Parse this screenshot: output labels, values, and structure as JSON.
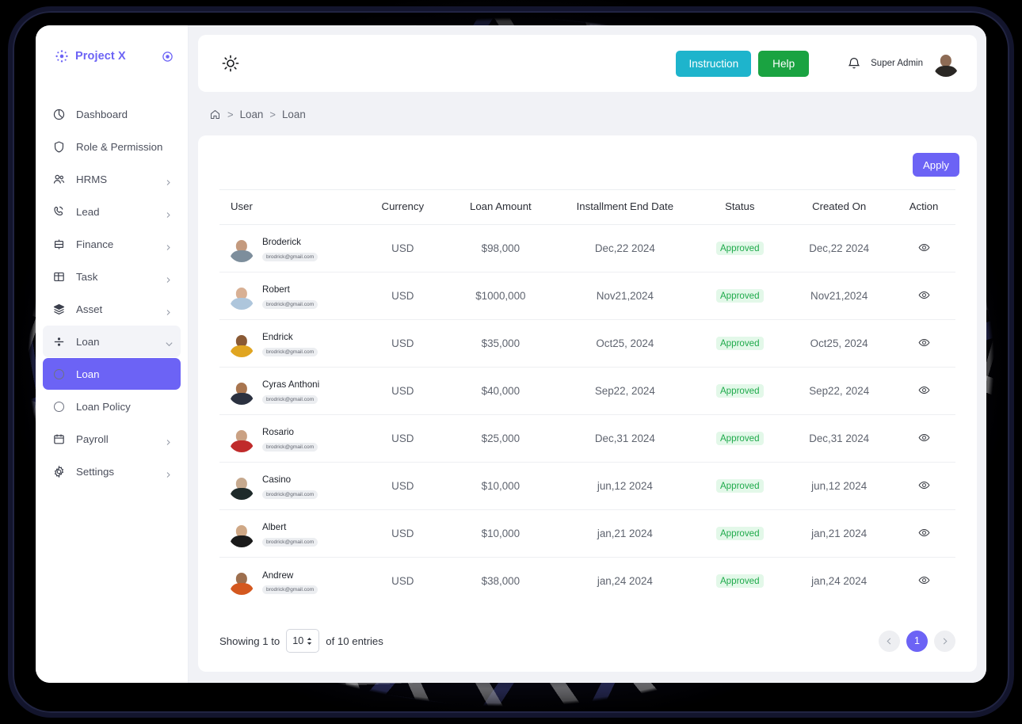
{
  "brand": {
    "name": "Project X",
    "logo_icon": "sparkle-icon",
    "collapse_icon": "circle-target-icon"
  },
  "sidebar": {
    "items": [
      {
        "label": "Dashboard",
        "icon": "pie-chart-icon",
        "expandable": false,
        "state": "normal"
      },
      {
        "label": "Role & Permission",
        "icon": "shield-icon",
        "expandable": false,
        "state": "normal"
      },
      {
        "label": "HRMS",
        "icon": "users-icon",
        "expandable": true,
        "state": "normal"
      },
      {
        "label": "Lead",
        "icon": "phone-icon",
        "expandable": true,
        "state": "normal"
      },
      {
        "label": "Finance",
        "icon": "bank-icon",
        "expandable": true,
        "state": "normal"
      },
      {
        "label": "Task",
        "icon": "grid-icon",
        "expandable": true,
        "state": "normal"
      },
      {
        "label": "Asset",
        "icon": "layers-icon",
        "expandable": true,
        "state": "normal"
      },
      {
        "label": "Loan",
        "icon": "divide-icon",
        "expandable": true,
        "state": "open"
      },
      {
        "label": "Loan",
        "icon": "circle-icon",
        "expandable": false,
        "state": "active",
        "sub": true
      },
      {
        "label": "Loan Policy",
        "icon": "circle-icon",
        "expandable": false,
        "state": "normal",
        "sub": true
      },
      {
        "label": "Payroll",
        "icon": "calendar-icon",
        "expandable": true,
        "state": "normal"
      },
      {
        "label": "Settings",
        "icon": "gear-icon",
        "expandable": true,
        "state": "normal"
      }
    ]
  },
  "topbar": {
    "theme_icon": "sun-icon",
    "instruction_label": "Instruction",
    "help_label": "Help",
    "bell_icon": "bell-icon",
    "user_name": "Super Admin",
    "avatar_icon": "user-avatar"
  },
  "breadcrumb": {
    "home_icon": "home-icon",
    "sep": ">",
    "items": [
      "Loan",
      "Loan"
    ]
  },
  "toolbar": {
    "apply_label": "Apply"
  },
  "table": {
    "headers": [
      "User",
      "Currency",
      "Loan Amount",
      "Installment End Date",
      "Status",
      "Created On",
      "Action"
    ],
    "action_icon": "eye-icon",
    "rows": [
      {
        "name": "Broderick",
        "email": "brodrick@gmail.com",
        "currency": "USD",
        "amount": "$98,000",
        "end_date": "Dec,22 2024",
        "status": "Approved",
        "created_on": "Dec,22 2024",
        "skin": "#c49a7e",
        "cloth": "#7d8e9c"
      },
      {
        "name": "Robert",
        "email": "brodrick@gmail.com",
        "currency": "USD",
        "amount": "$1000,000",
        "end_date": "Nov21,2024",
        "status": "Approved",
        "created_on": "Nov21,2024",
        "skin": "#d8b094",
        "cloth": "#aec6dc"
      },
      {
        "name": "Endrick",
        "email": "brodrick@gmail.com",
        "currency": "USD",
        "amount": "$35,000",
        "end_date": "Oct25, 2024",
        "status": "Approved",
        "created_on": "Oct25, 2024",
        "skin": "#8a5a35",
        "cloth": "#e0a521"
      },
      {
        "name": "Cyras Anthoni",
        "email": "brodrick@gmail.com",
        "currency": "USD",
        "amount": "$40,000",
        "end_date": "Sep22, 2024",
        "status": "Approved",
        "created_on": "Sep22, 2024",
        "skin": "#a8754f",
        "cloth": "#2b3140"
      },
      {
        "name": "Rosario",
        "email": "brodrick@gmail.com",
        "currency": "USD",
        "amount": "$25,000",
        "end_date": "Dec,31 2024",
        "status": "Approved",
        "created_on": "Dec,31 2024",
        "skin": "#caa183",
        "cloth": "#c02b2b"
      },
      {
        "name": "Casino",
        "email": "brodrick@gmail.com",
        "currency": "USD",
        "amount": "$10,000",
        "end_date": "jun,12 2024",
        "status": "Approved",
        "created_on": "jun,12 2024",
        "skin": "#c6a98e",
        "cloth": "#1e2a2a"
      },
      {
        "name": "Albert",
        "email": "brodrick@gmail.com",
        "currency": "USD",
        "amount": "$10,000",
        "end_date": "jan,21 2024",
        "status": "Approved",
        "created_on": "jan,21 2024",
        "skin": "#cfa886",
        "cloth": "#1a1a1a"
      },
      {
        "name": "Andrew",
        "email": "brodrick@gmail.com",
        "currency": "USD",
        "amount": "$38,000",
        "end_date": "jan,24 2024",
        "status": "Approved",
        "created_on": "jan,24 2024",
        "skin": "#9d6f4e",
        "cloth": "#d4581f"
      }
    ]
  },
  "footer": {
    "showing_prefix": "Showing 1 to",
    "page_size": "10",
    "showing_suffix": "of 10 entries",
    "prev_icon": "chevron-left-icon",
    "next_icon": "chevron-right-icon",
    "current_page": "1"
  },
  "colors": {
    "accent": "#6c63f5",
    "instruction": "#1eb4cc",
    "help": "#1aa341",
    "approved_text": "#1faa4b",
    "approved_bg": "#e3f8e9",
    "page_bg": "#f1f2f6"
  }
}
